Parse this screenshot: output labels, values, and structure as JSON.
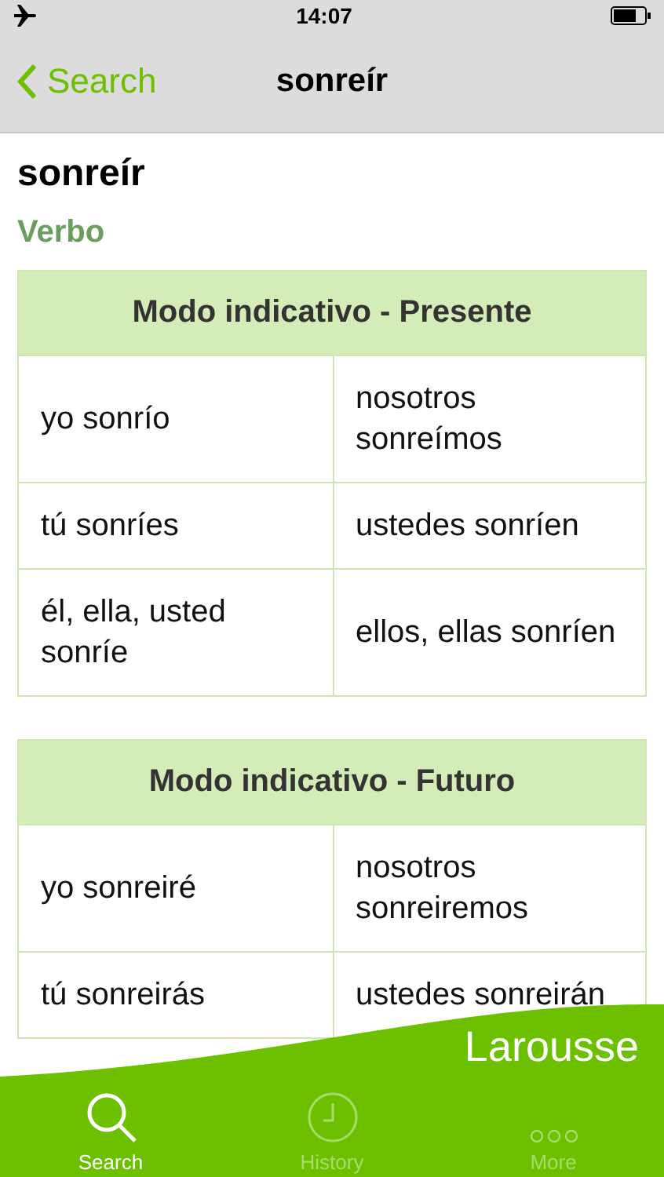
{
  "status_bar": {
    "time": "14:07"
  },
  "nav": {
    "back": "Search",
    "title": "sonreír"
  },
  "entry": {
    "word": "sonreír",
    "category": "Verbo"
  },
  "tables": [
    {
      "title": "Modo indicativo - Presente",
      "rows": [
        [
          "yo sonrío",
          "nosotros sonreímos"
        ],
        [
          "tú sonríes",
          "ustedes sonríen"
        ],
        [
          "él, ella, usted sonríe",
          "ellos, ellas sonríen"
        ]
      ]
    },
    {
      "title": "Modo indicativo - Futuro",
      "rows": [
        [
          "yo sonreiré",
          "nosotros sonreiremos"
        ],
        [
          "tú sonreirás",
          "ustedes sonreirán"
        ]
      ]
    }
  ],
  "brand": "Larousse",
  "tabs": [
    {
      "label": "Search",
      "kind": "search",
      "selected": true
    },
    {
      "label": "History",
      "kind": "history",
      "selected": false
    },
    {
      "label": "More",
      "kind": "more",
      "selected": false
    }
  ]
}
